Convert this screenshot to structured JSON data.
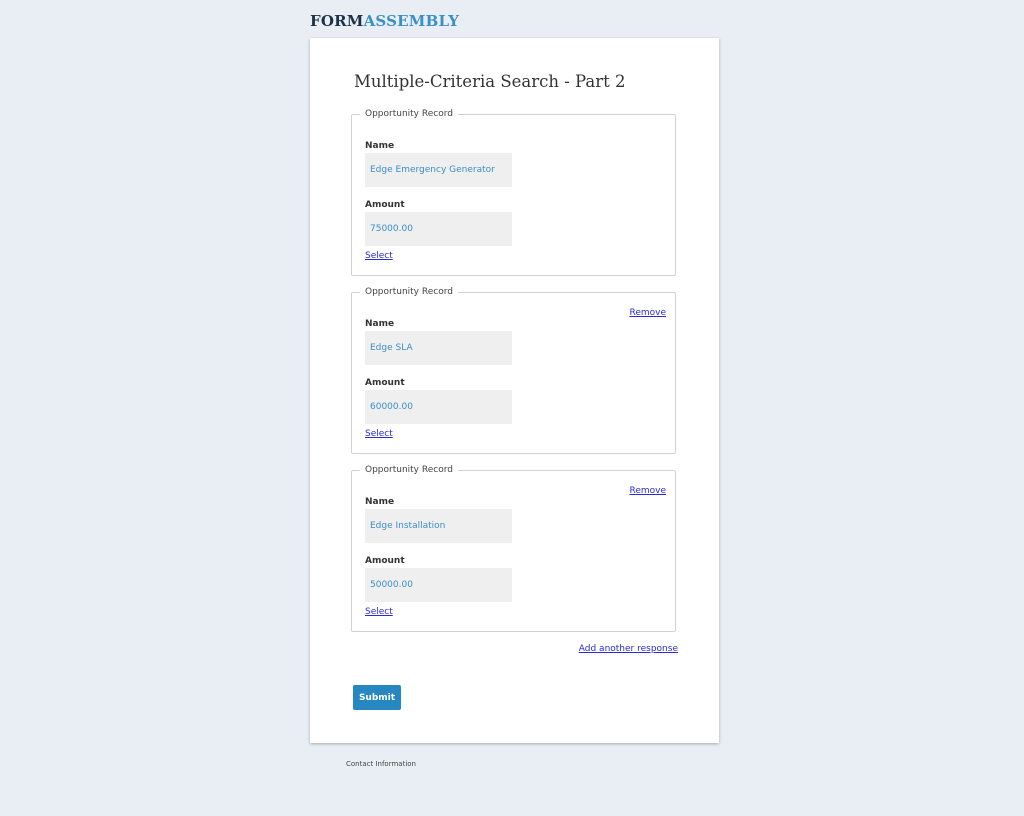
{
  "logo": {
    "part1": "FORM",
    "part2": "ASSEMBLY"
  },
  "form": {
    "title": "Multiple-Criteria Search - Part 2",
    "records": [
      {
        "legend": "Opportunity Record",
        "remove_label": "",
        "name_label": "Name",
        "name_value": "Edge Emergency Generator",
        "amount_label": "Amount",
        "amount_value": "75000.00",
        "select_label": "Select"
      },
      {
        "legend": "Opportunity Record",
        "remove_label": "Remove",
        "name_label": "Name",
        "name_value": "Edge SLA",
        "amount_label": "Amount",
        "amount_value": "60000.00",
        "select_label": "Select"
      },
      {
        "legend": "Opportunity Record",
        "remove_label": "Remove",
        "name_label": "Name",
        "name_value": "Edge Installation",
        "amount_label": "Amount",
        "amount_value": "50000.00",
        "select_label": "Select"
      }
    ],
    "add_another_label": "Add another response",
    "submit_label": "Submit"
  },
  "footer": {
    "contact_label": "Contact Information"
  },
  "colors": {
    "background": "#e8eef4",
    "accent": "#2787c0",
    "link": "#2a2ad8",
    "value_text": "#3a8fc6"
  }
}
